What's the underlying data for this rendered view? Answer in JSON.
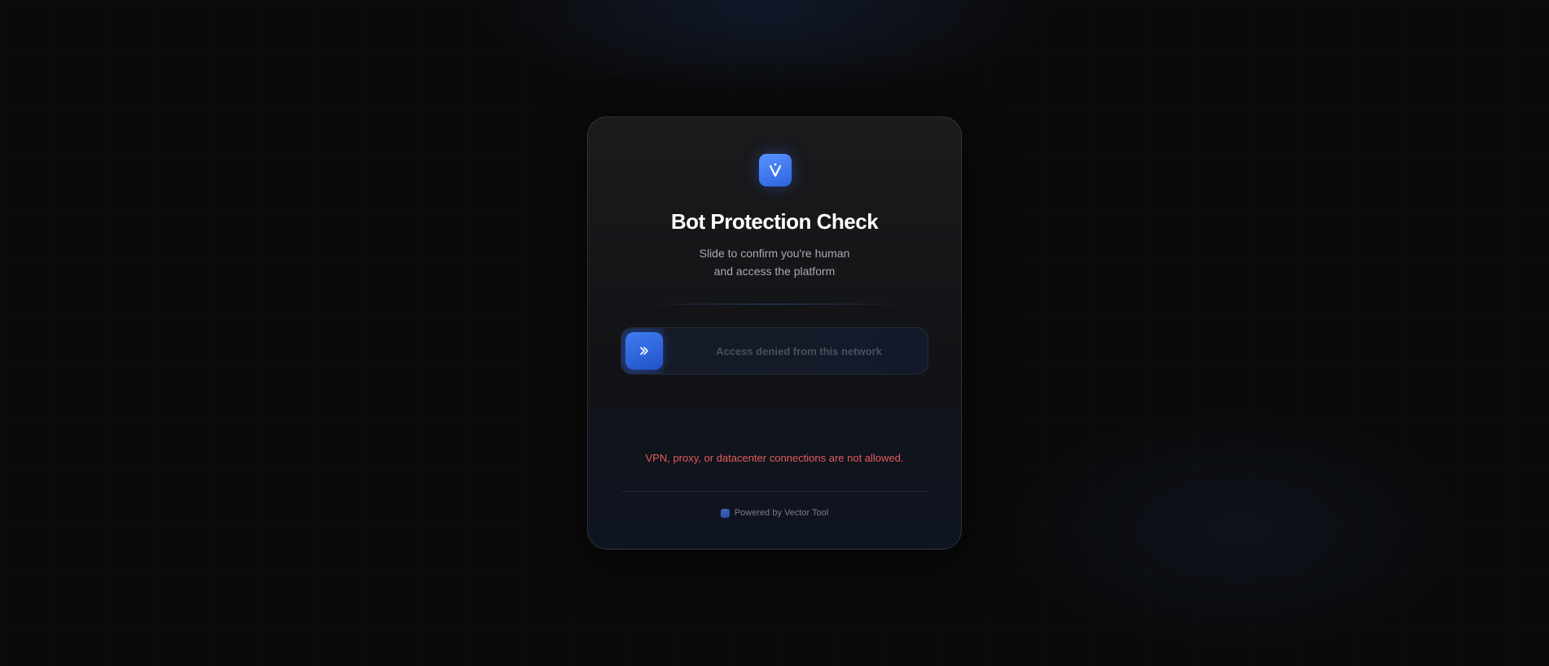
{
  "card": {
    "title": "Bot Protection Check",
    "subtitle_line1": "Slide to confirm you're human",
    "subtitle_line2": "and access the platform"
  },
  "slider": {
    "label": "Access denied from this network",
    "handle_icon": "double-chevron-right-icon",
    "progress": 0
  },
  "error": {
    "message": "VPN, proxy, or datacenter connections are not allowed."
  },
  "footer": {
    "text": "Powered by Vector Tool"
  },
  "colors": {
    "accent": "#3f7df0",
    "error": "#e45d5d"
  }
}
